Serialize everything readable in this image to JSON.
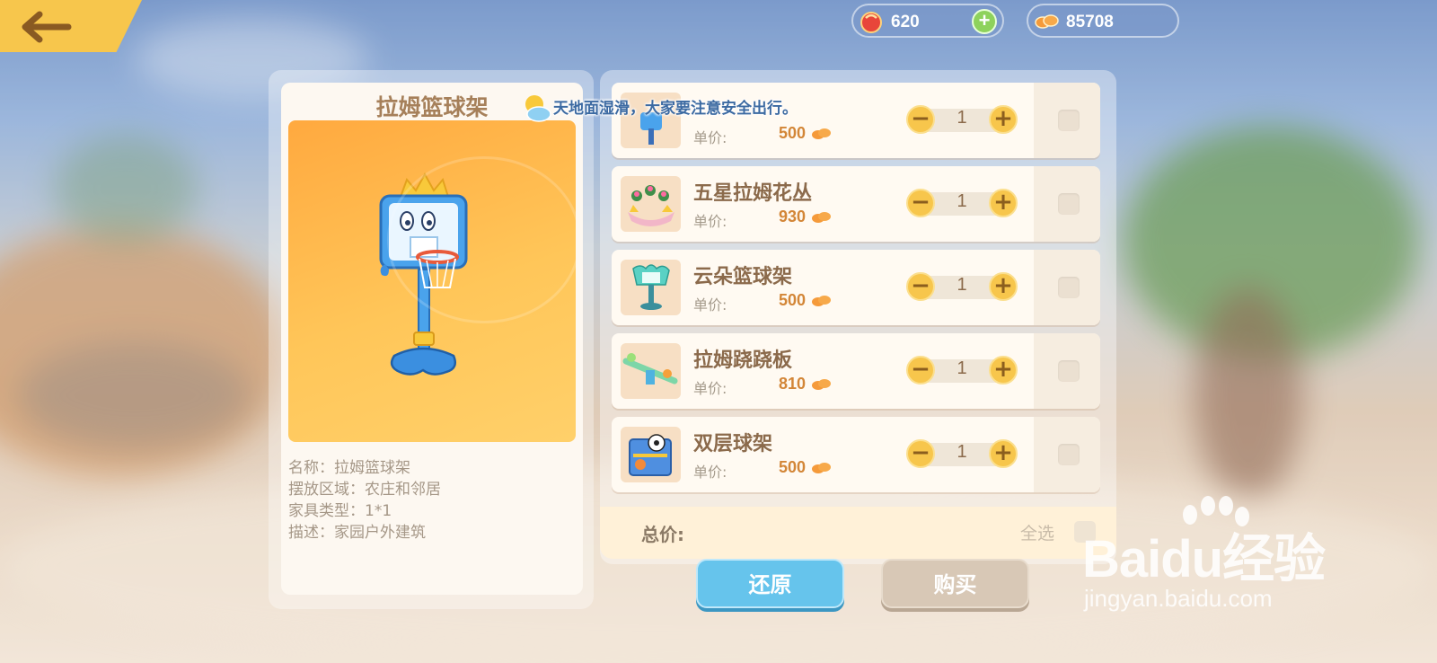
{
  "currency": {
    "gems": "620",
    "coins": "85708"
  },
  "weather_notice": "天地面湿滑，大家要注意安全出行。",
  "detail": {
    "title": "拉姆篮球架",
    "name_line": "名称：拉姆篮球架",
    "area_line": "摆放区域：农庄和邻居",
    "type_line": "家具类型：1*1",
    "desc_line": "描述：家园户外建筑"
  },
  "items": [
    {
      "name": "",
      "price_label": "单价:",
      "price": "500",
      "qty": "1"
    },
    {
      "name": "五星拉姆花丛",
      "price_label": "单价:",
      "price": "930",
      "qty": "1"
    },
    {
      "name": "云朵篮球架",
      "price_label": "单价:",
      "price": "500",
      "qty": "1"
    },
    {
      "name": "拉姆跷跷板",
      "price_label": "单价:",
      "price": "810",
      "qty": "1"
    },
    {
      "name": "双层球架",
      "price_label": "单价:",
      "price": "500",
      "qty": "1"
    }
  ],
  "total": {
    "label": "总价:",
    "select_all": "全选"
  },
  "buttons": {
    "reset": "还原",
    "buy": "购买"
  },
  "watermark": {
    "logo": "Baidu经验",
    "url": "jingyan.baidu.com"
  }
}
